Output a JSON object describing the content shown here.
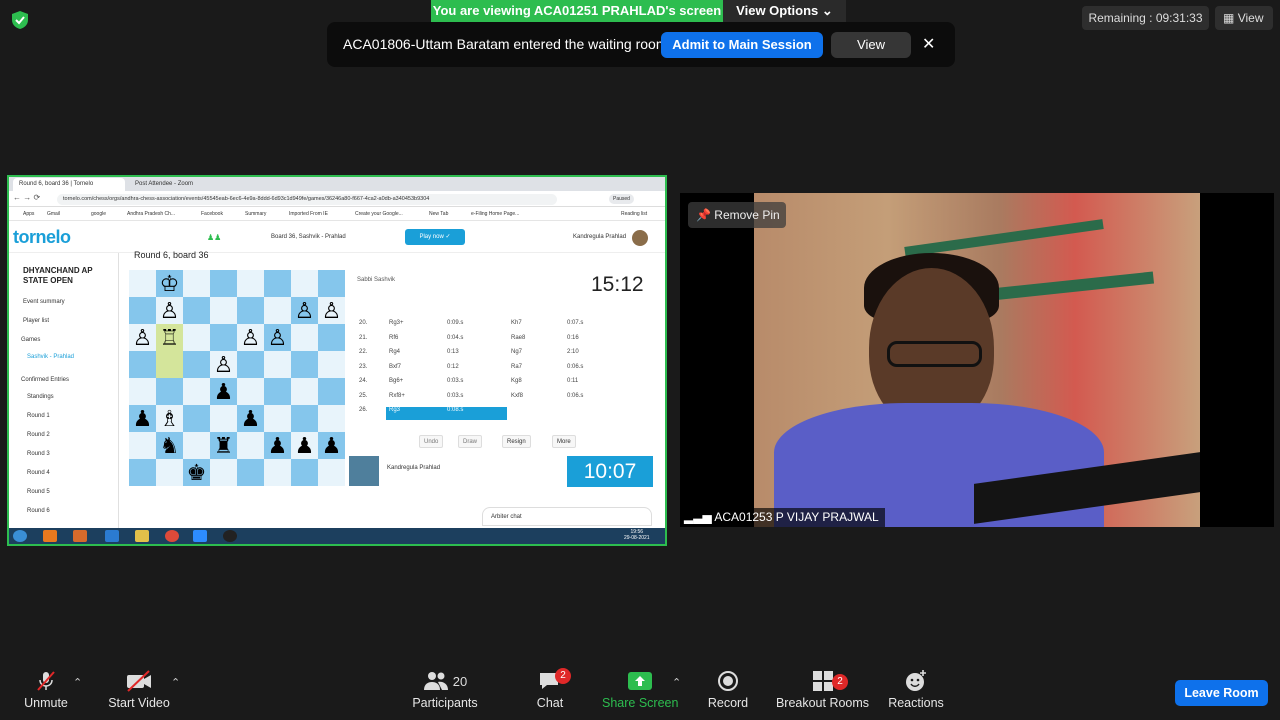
{
  "top": {
    "viewing_banner": "You are viewing ACA01251 PRAHLAD's screen",
    "view_options": "View Options",
    "remaining": "Remaining : 09:31:33",
    "view_label": "View"
  },
  "notification": {
    "text": "ACA01806-Uttam Baratam entered the waiting room",
    "admit": "Admit to Main Session",
    "view": "View",
    "close": "✕"
  },
  "shared": {
    "tabs": [
      "Round 6, board 36 | Tornelo",
      "Post Attendee - Zoom"
    ],
    "url": "tornelo.com/chess/orgs/andhra-chess-association/events/45545eab-6ec6-4e9a-8ddd-6d93c1d949fe/games/36246a80-f667-4ca2-a0db-a340453b9304",
    "paused": "Paused",
    "bookmarks": [
      "Apps",
      "Gmail",
      "google",
      "Andhra Pradesh Ch...",
      "Facebook",
      "Summary",
      "Imported From IE",
      "Create your Google...",
      "New Tab",
      "e-Filing Home Page...",
      "Reading list"
    ],
    "logo": "tornelo",
    "board_title": "Board 36, Sashvik - Prahlad",
    "play_now": "Play now ✓",
    "user": "Kandregula Prahlad",
    "event_title": "DHYANCHAND AP STATE OPEN",
    "sidebar_items": [
      "Event summary",
      "Player list",
      "Games",
      "Sashvik - Prahlad",
      "Confirmed Entries",
      "Standings",
      "Round 1",
      "Round 2",
      "Round 3",
      "Round 4",
      "Round 5",
      "Round 6"
    ],
    "round_title": "Round 6, board 36",
    "top_player": "Sabbi Sashvik",
    "top_clock": "15:12",
    "moves": [
      {
        "n": "20.",
        "w": "Rg3+",
        "wt": "0:09.s",
        "b": "Kh7",
        "bt": "0:07.s"
      },
      {
        "n": "21.",
        "w": "Rf6",
        "wt": "0:04.s",
        "b": "Rae8",
        "bt": "0:16"
      },
      {
        "n": "22.",
        "w": "Rg4",
        "wt": "0:13",
        "b": "Ng7",
        "bt": "2:10"
      },
      {
        "n": "23.",
        "w": "Bxf7",
        "wt": "0:12",
        "b": "Ra7",
        "bt": "0:06.s"
      },
      {
        "n": "24.",
        "w": "Bg6+",
        "wt": "0:03.s",
        "b": "Kg8",
        "bt": "0:11"
      },
      {
        "n": "25.",
        "w": "Rxf8+",
        "wt": "0:03.s",
        "b": "Kxf8",
        "bt": "0:06.s"
      },
      {
        "n": "26.",
        "w": "Rg3",
        "wt": "0:08.s",
        "b": "",
        "bt": ""
      }
    ],
    "controls": [
      "Undo",
      "Draw",
      "Resign",
      "More"
    ],
    "bottom_player": "Kandregula Prahlad",
    "bottom_clock": "10:07",
    "arbiter_chat": "Arbiter chat",
    "task_time": "19:56",
    "task_date": "29-08-2021"
  },
  "video": {
    "remove_pin": "Remove Pin",
    "participant_name": "ACA01253 P VIJAY PRAJWAL"
  },
  "toolbar": {
    "unmute": "Unmute",
    "start_video": "Start Video",
    "participants": "Participants",
    "participants_count": "20",
    "chat": "Chat",
    "chat_badge": "2",
    "share_screen": "Share Screen",
    "record": "Record",
    "breakout": "Breakout Rooms",
    "breakout_badge": "2",
    "reactions": "Reactions",
    "leave": "Leave Room"
  },
  "colors": {
    "zoom_blue": "#0e71eb",
    "share_green": "#2dbd4f",
    "badge_red": "#e02828",
    "tornelo_blue": "#1a9fd8"
  }
}
